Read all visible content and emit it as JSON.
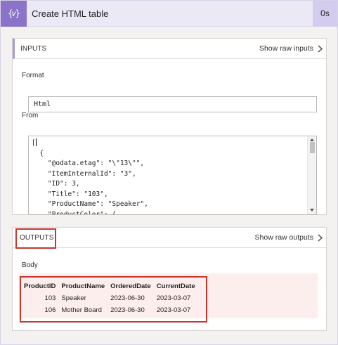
{
  "action": {
    "icon": "variable-braces-icon",
    "icon_glyph": "{𝑣}",
    "title": "Create HTML table",
    "duration": "0s"
  },
  "inputs": {
    "title": "INPUTS",
    "show_raw": "Show raw inputs",
    "format_label": "Format",
    "format_value": "Html",
    "from_label": "From",
    "from_lines": [
      "",
      "  {",
      "    \"@odata.etag\": \"\\\"13\\\"\",",
      "    \"ItemInternalId\": \"3\",",
      "    \"ID\": 3,",
      "    \"Title\": \"103\",",
      "    \"ProductName\": \"Speaker\",",
      "    \"ProductColor\": {"
    ],
    "from_first_char": "["
  },
  "outputs": {
    "title": "OUTPUTS",
    "show_raw": "Show raw outputs",
    "body_label": "Body",
    "table": {
      "headers": [
        "ProductID",
        "ProductName",
        "OrderedDate",
        "CurrentDate"
      ],
      "rows": [
        [
          "103",
          "Speaker",
          "2023-06-30",
          "2023-03-07"
        ],
        [
          "106",
          "Mother Board",
          "2023-06-30",
          "2023-03-07"
        ]
      ]
    }
  },
  "colors": {
    "accent": "#8a73c8",
    "header_bg": "#ece9f7",
    "highlight": "#c8362f",
    "body_bg": "#fdeeee"
  }
}
